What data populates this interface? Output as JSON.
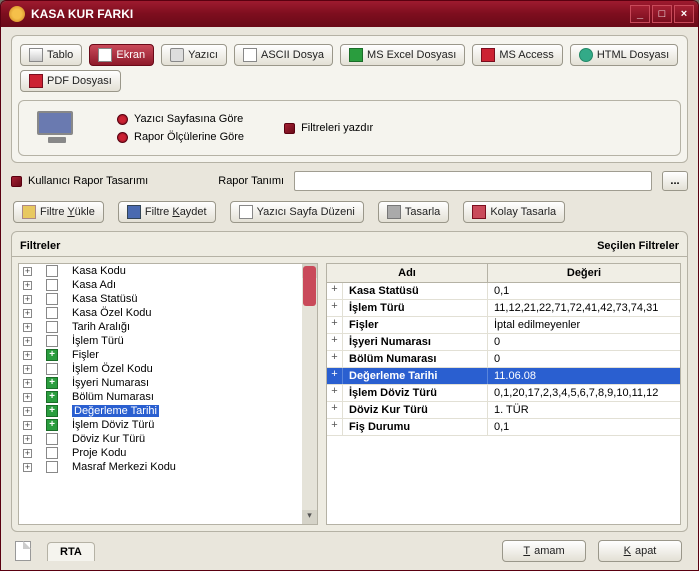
{
  "window": {
    "title": "KASA KUR FARKI",
    "min": "_",
    "max": "□",
    "close": "×"
  },
  "toolbar": {
    "tablo": "Tablo",
    "ekran": "Ekran",
    "yazici": "Yazıcı",
    "ascii": "ASCII Dosya",
    "excel": "MS Excel Dosyası",
    "access": "MS Access",
    "html": "HTML Dosyası",
    "pdf": "PDF Dosyası"
  },
  "options": {
    "yazici_sayfa": "Yazıcı Sayfasına Göre",
    "rapor_olcu": "Rapor Ölçülerine Göre",
    "filtreleri_yazdir": "Filtreleri yazdır"
  },
  "design": {
    "kullanici_rapor": "Kullanıcı Rapor Tasarımı",
    "rapor_tanimi": "Rapor Tanımı",
    "ellipsis": "..."
  },
  "filter_toolbar": {
    "yukle": "Filtre Yükle",
    "kaydet": "Filtre Kaydet",
    "sayfa_duzeni": "Yazıcı Sayfa Düzeni",
    "tasarla": "Tasarla",
    "kolay_tasarla": "Kolay Tasarla"
  },
  "labels": {
    "filtreler": "Filtreler",
    "secilen": "Seçilen Filtreler",
    "adi": "Adı",
    "degeri": "Değeri"
  },
  "tree": [
    {
      "label": "Kasa Kodu",
      "checked": false
    },
    {
      "label": "Kasa Adı",
      "checked": false
    },
    {
      "label": "Kasa Statüsü",
      "checked": false
    },
    {
      "label": "Kasa Özel Kodu",
      "checked": false
    },
    {
      "label": "Tarih Aralığı",
      "checked": false
    },
    {
      "label": "İşlem Türü",
      "checked": false
    },
    {
      "label": "Fişler",
      "checked": true
    },
    {
      "label": "İşlem Özel Kodu",
      "checked": false
    },
    {
      "label": "İşyeri Numarası",
      "checked": true
    },
    {
      "label": "Bölüm Numarası",
      "checked": true
    },
    {
      "label": "Değerleme Tarihi",
      "checked": true,
      "selected": true
    },
    {
      "label": "İşlem Döviz Türü",
      "checked": true
    },
    {
      "label": "Döviz Kur Türü",
      "checked": false
    },
    {
      "label": "Proje Kodu",
      "checked": false
    },
    {
      "label": "Masraf Merkezi Kodu",
      "checked": false
    }
  ],
  "selected": [
    {
      "name": "Kasa Statüsü",
      "value": "0,1"
    },
    {
      "name": "İşlem Türü",
      "value": "11,12,21,22,71,72,41,42,73,74,31"
    },
    {
      "name": "Fişler",
      "value": "İptal edilmeyenler"
    },
    {
      "name": "İşyeri Numarası",
      "value": "0"
    },
    {
      "name": "Bölüm Numarası",
      "value": "0"
    },
    {
      "name": "Değerleme Tarihi",
      "value": "11.06.08",
      "selected": true
    },
    {
      "name": "İşlem Döviz Türü",
      "value": "0,1,20,17,2,3,4,5,6,7,8,9,10,11,12"
    },
    {
      "name": "Döviz Kur Türü",
      "value": "1. TÜR"
    },
    {
      "name": "Fiş Durumu",
      "value": "0,1"
    }
  ],
  "footer": {
    "rta": "RTA",
    "tamam": "Tamam",
    "kapat": "Kapat"
  }
}
